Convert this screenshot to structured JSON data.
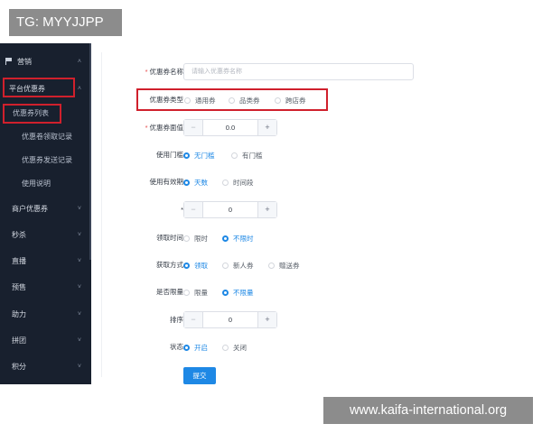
{
  "watermarks": {
    "top": "TG: MYYJJPP",
    "bottom": "www.kaifa-international.org"
  },
  "sidebar": {
    "items": [
      {
        "label": "营销",
        "icon": "flag-icon",
        "chevron": "˄"
      },
      {
        "label": "平台优惠券",
        "chevron": "˄"
      },
      {
        "label": "优惠券列表"
      },
      {
        "label": "优惠卷领取记录"
      },
      {
        "label": "优惠券发送记录"
      },
      {
        "label": "使用说明"
      },
      {
        "label": "商户优惠券",
        "chevron": "˅"
      },
      {
        "label": "秒杀",
        "chevron": "˅"
      },
      {
        "label": "直播",
        "chevron": "˅"
      },
      {
        "label": "预售",
        "chevron": "˅"
      },
      {
        "label": "助力",
        "chevron": "˅"
      },
      {
        "label": "拼团",
        "chevron": "˅"
      },
      {
        "label": "积分",
        "chevron": "˅"
      }
    ]
  },
  "form": {
    "name": {
      "label": "优惠券名称",
      "placeholder": "请输入优惠券名称"
    },
    "coupon_type": {
      "label": "优惠券类型",
      "options": [
        "通用券",
        "品类券",
        "跨店券"
      ]
    },
    "face_value": {
      "label": "优惠券面值",
      "value": "0.0",
      "minus": "−",
      "plus": "+"
    },
    "threshold": {
      "label": "使用门槛",
      "options": [
        "无门槛",
        "有门槛"
      ],
      "selected": "无门槛"
    },
    "validity": {
      "label": "使用有效期",
      "options": [
        "天数",
        "时间段"
      ],
      "selected": "天数"
    },
    "days": {
      "label": "*",
      "value": "0",
      "minus": "−",
      "plus": "+"
    },
    "receive_time": {
      "label": "领取时间",
      "options": [
        "限时",
        "不限时"
      ],
      "selected": "不限时"
    },
    "receive_method": {
      "label": "获取方式",
      "options": [
        "领取",
        "新人券",
        "赠送券"
      ],
      "selected": "领取"
    },
    "limit": {
      "label": "是否限量",
      "options": [
        "限量",
        "不限量"
      ],
      "selected": "不限量"
    },
    "sort": {
      "label": "排序",
      "value": "0",
      "minus": "−",
      "plus": "+"
    },
    "status": {
      "label": "状态",
      "options": [
        "开启",
        "关闭"
      ],
      "selected": "开启"
    },
    "submit_label": "提交"
  },
  "colors": {
    "sidebar_bg": "#18202e",
    "accent": "#1e88e5",
    "highlight_box": "#d0202c"
  }
}
